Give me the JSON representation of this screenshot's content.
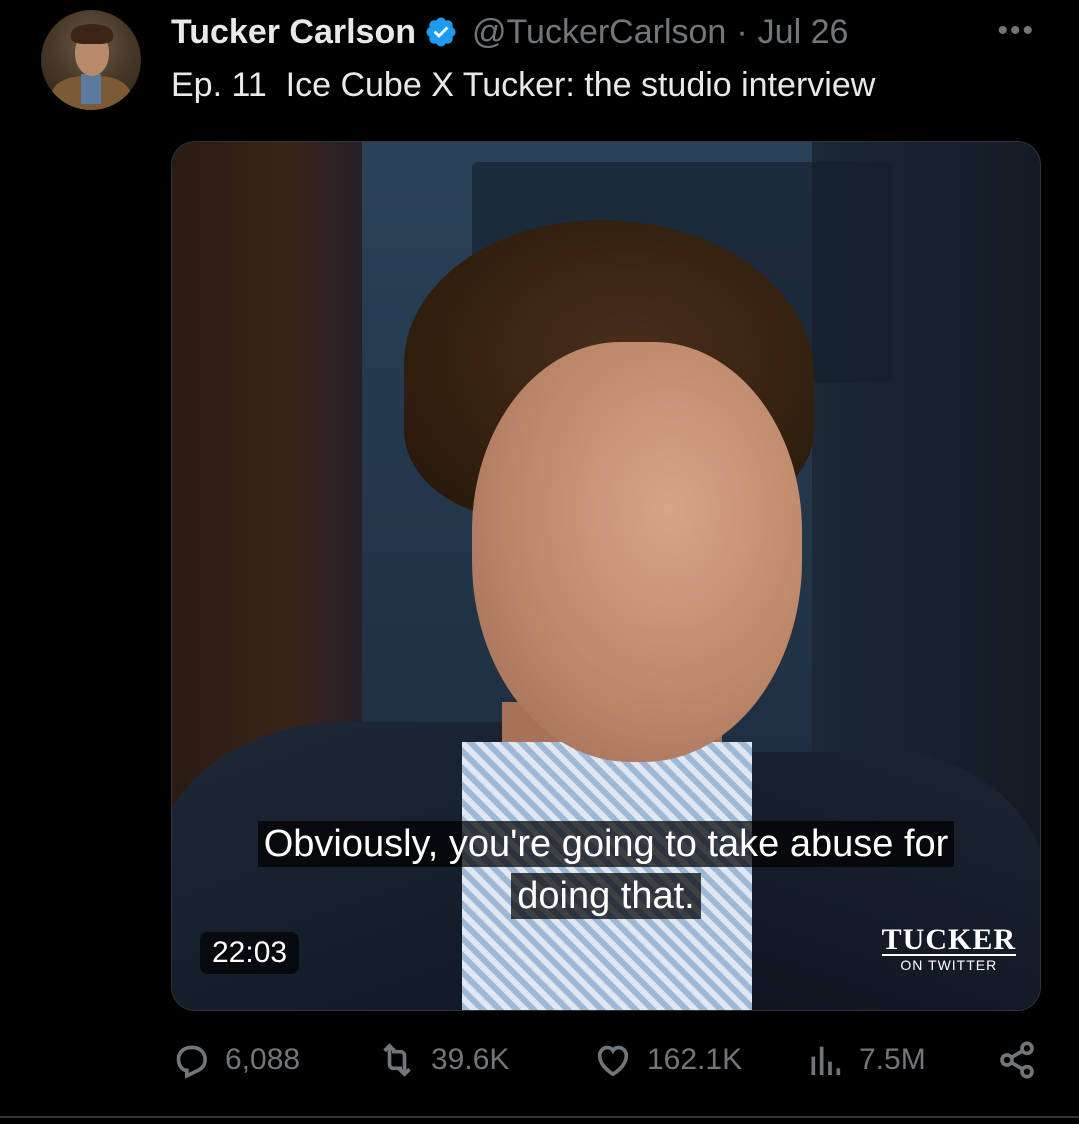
{
  "author": {
    "name": "Tucker Carlson",
    "handle": "@TuckerCarlson",
    "separator": "·",
    "date": "Jul 26",
    "verified_color": "#1d9bf0"
  },
  "more_label": "•••",
  "tweet": {
    "text": "Ep. 11  Ice Cube X Tucker: the studio interview"
  },
  "media": {
    "subtitle_line1": "Obviously, you're going to take abuse for",
    "subtitle_line2": "doing that.",
    "duration": "22:03",
    "brand_big": "TUCKER",
    "brand_small": "ON TWITTER"
  },
  "stats": {
    "replies": "6,088",
    "reposts": "39.6K",
    "likes": "162.1K",
    "views": "7.5M"
  },
  "icons": {
    "reply": "reply-icon",
    "repost": "repost-icon",
    "like": "heart-icon",
    "views": "views-icon",
    "share": "share-icon"
  },
  "colors": {
    "background": "#000000",
    "text": "#e7e9ea",
    "secondary": "#71767b"
  }
}
